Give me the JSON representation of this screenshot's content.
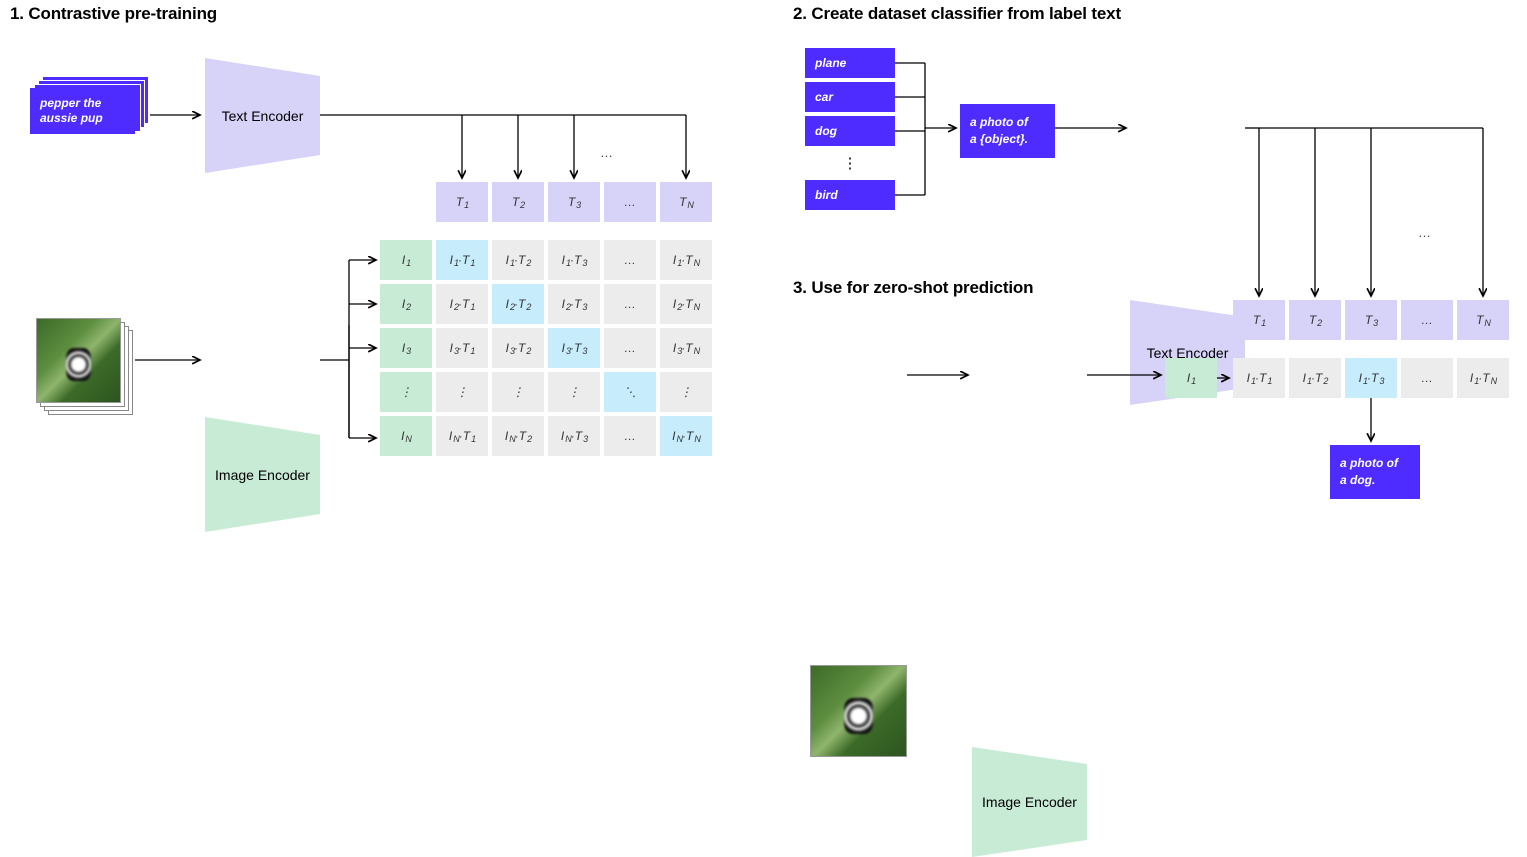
{
  "section1": {
    "title": "1. Contrastive pre-training",
    "caption": "pepper the aussie pup",
    "text_encoder": "Text Encoder",
    "image_encoder": "Image Encoder",
    "t_header": [
      "T₁",
      "T₂",
      "T₃",
      "…",
      "T_N"
    ],
    "i_header": [
      "I₁",
      "I₂",
      "I₃",
      "⋮",
      "I_N"
    ],
    "matrix": [
      [
        "I₁·T₁",
        "I₁·T₂",
        "I₁·T₃",
        "…",
        "I₁·T_N"
      ],
      [
        "I₂·T₁",
        "I₂·T₂",
        "I₂·T₃",
        "…",
        "I₂·T_N"
      ],
      [
        "I₃·T₁",
        "I₃·T₂",
        "I₃·T₃",
        "…",
        "I₃·T_N"
      ],
      [
        "⋮",
        "⋮",
        "⋮",
        "⋱",
        "⋮"
      ],
      [
        "I_N·T₁",
        "I_N·T₂",
        "I_N·T₃",
        "…",
        "I_N·T_N"
      ]
    ],
    "top_ellipsis": "…"
  },
  "section2": {
    "title": "2. Create dataset classifier from label text",
    "labels": [
      "plane",
      "car",
      "dog",
      "bird"
    ],
    "vdots": "⋮",
    "prompt_l1": "a photo of",
    "prompt_l2": "a {object}.",
    "text_encoder": "Text Encoder",
    "top_ellipsis": "…"
  },
  "section3": {
    "title": "3. Use for zero-shot prediction",
    "image_encoder": "Image Encoder",
    "i1": "I₁",
    "t_header": [
      "T₁",
      "T₂",
      "T₃",
      "…",
      "T_N"
    ],
    "row": [
      "I₁·T₁",
      "I₁·T₂",
      "I₁·T₃",
      "…",
      "I₁·T_N"
    ],
    "result_l1": "a photo of",
    "result_l2": "a dog."
  },
  "chart_data": {
    "type": "diagram",
    "description": "CLIP architecture diagram with three panels: contrastive pre-training (image/text encoders producing an N×N similarity matrix with diagonal highlighted), zero-shot classifier construction from label text via prompt template 'a photo of a {object}.', and zero-shot prediction picking the best-matching text embedding (dog) for an input image."
  }
}
